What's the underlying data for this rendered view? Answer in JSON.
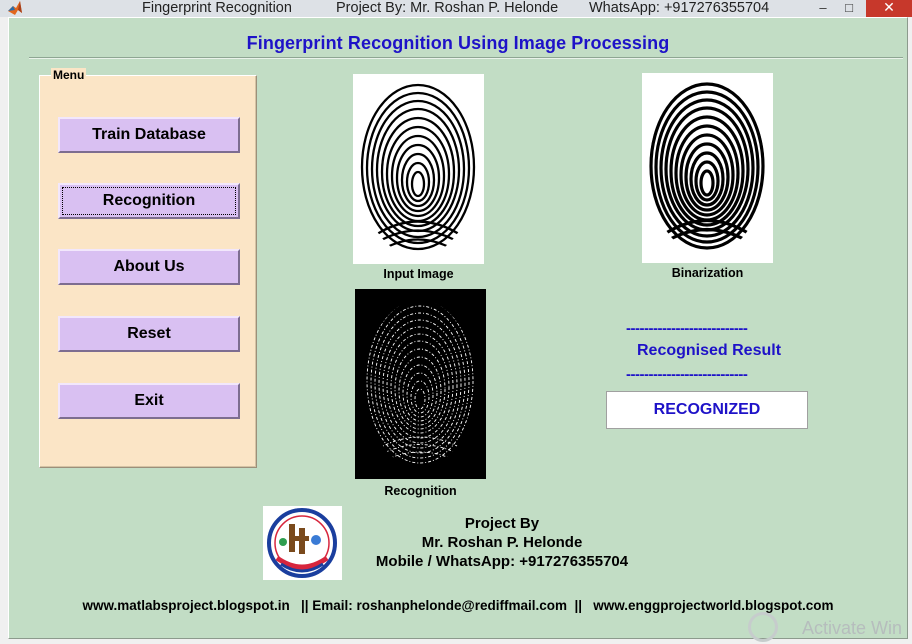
{
  "titlebar": {
    "app_name": "Fingerprint Recognition",
    "project_by": "Project By: Mr. Roshan P. Helonde",
    "whatsapp": "WhatsApp: +917276355704",
    "minimize_glyph": "–",
    "maximize_glyph": "□",
    "close_glyph": "✕",
    "app_icon": "matlab-logo-icon"
  },
  "main": {
    "title": "Fingerprint Recognition Using Image Processing"
  },
  "menu": {
    "legend": "Menu",
    "buttons": [
      {
        "label": "Train Database"
      },
      {
        "label": "Recognition"
      },
      {
        "label": "About Us"
      },
      {
        "label": "Reset"
      },
      {
        "label": "Exit"
      }
    ]
  },
  "images": {
    "input_caption": "Input Image",
    "binarization_caption": "Binarization",
    "recognition_caption": "Recognition"
  },
  "result": {
    "dashes": "---------------------------",
    "label": "Recognised Result",
    "value": "RECOGNIZED"
  },
  "credits": {
    "line1": "Project By",
    "line2": "Mr. Roshan P. Helonde",
    "line3": "Mobile / WhatsApp: +917276355704"
  },
  "footer": {
    "text": "www.matlabsproject.blogspot.in   || Email: roshanphelonde@rediffmail.com  ||   www.enggprojectworld.blogspot.com"
  },
  "watermark": {
    "text": "Activate Win"
  },
  "colors": {
    "background": "#c2ddc5",
    "title_blue": "#1e12c8",
    "menu_panel": "#fbe5c6",
    "button": "#d9c0f2",
    "close_red": "#c7382b"
  }
}
